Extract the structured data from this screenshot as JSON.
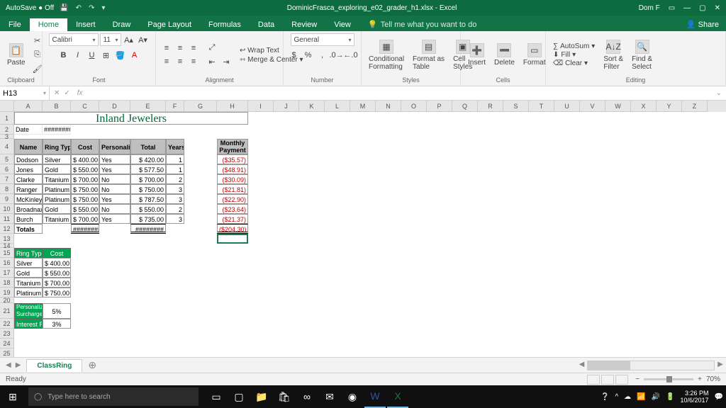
{
  "titlebar": {
    "autosave": "AutoSave ● Off",
    "title": "DominicFrasca_exploring_e02_grader_h1.xlsx - Excel",
    "user": "Dom F"
  },
  "tabs": {
    "file": "File",
    "home": "Home",
    "insert": "Insert",
    "draw": "Draw",
    "pagelayout": "Page Layout",
    "formulas": "Formulas",
    "data": "Data",
    "review": "Review",
    "view": "View",
    "tellme": "Tell me what you want to do",
    "share": "Share"
  },
  "ribbon": {
    "clipboard": {
      "label": "Clipboard",
      "paste": "Paste"
    },
    "font": {
      "label": "Font",
      "name": "Calibri",
      "size": "11"
    },
    "alignment": {
      "label": "Alignment",
      "wrap": "Wrap Text",
      "merge": "Merge & Center"
    },
    "number": {
      "label": "Number",
      "format": "General"
    },
    "styles": {
      "label": "Styles",
      "cond": "Conditional\nFormatting",
      "table": "Format as\nTable",
      "cell": "Cell\nStyles"
    },
    "cells": {
      "label": "Cells",
      "insert": "Insert",
      "delete": "Delete",
      "format": "Format"
    },
    "editing": {
      "label": "Editing",
      "autosum": "AutoSum",
      "fill": "Fill",
      "clear": "Clear",
      "sort": "Sort &\nFilter",
      "find": "Find &\nSelect"
    }
  },
  "namebox": "H13",
  "fx": "",
  "cols": [
    "A",
    "B",
    "C",
    "D",
    "E",
    "F",
    "G",
    "H",
    "I",
    "J",
    "K",
    "L",
    "M",
    "N",
    "O",
    "P",
    "Q",
    "R",
    "S",
    "T",
    "U",
    "V",
    "W",
    "X",
    "Y",
    "Z"
  ],
  "sheet": {
    "title": "Inland Jewelers",
    "date_label": "Date",
    "date_val": "########",
    "headers": [
      "Name",
      "Ring Type",
      "Cost",
      "Personalized",
      "Total",
      "Years",
      "Monthly\nPayment"
    ],
    "rows": [
      {
        "name": "Dodson",
        "type": "Silver",
        "cost": "$  400.00",
        "pers": "Yes",
        "total": "$   420.00",
        "years": "1",
        "pay": "($35.57)"
      },
      {
        "name": "Jones",
        "type": "Gold",
        "cost": "$  550.00",
        "pers": "Yes",
        "total": "$   577.50",
        "years": "1",
        "pay": "($48.91)"
      },
      {
        "name": "Clarke",
        "type": "Titanium",
        "cost": "$  700.00",
        "pers": "No",
        "total": "$   700.00",
        "years": "2",
        "pay": "($30.09)"
      },
      {
        "name": "Ranger",
        "type": "Platinum",
        "cost": "$  750.00",
        "pers": "No",
        "total": "$   750.00",
        "years": "3",
        "pay": "($21.81)"
      },
      {
        "name": "McKinley",
        "type": "Platinum",
        "cost": "$  750.00",
        "pers": "Yes",
        "total": "$   787.50",
        "years": "3",
        "pay": "($22.90)"
      },
      {
        "name": "Broadnax",
        "type": "Gold",
        "cost": "$  550.00",
        "pers": "No",
        "total": "$   550.00",
        "years": "2",
        "pay": "($23.64)"
      },
      {
        "name": "Burch",
        "type": "Titanium",
        "cost": "$  700.00",
        "pers": "Yes",
        "total": "$   735.00",
        "years": "3",
        "pay": "($21.37)"
      }
    ],
    "totals": {
      "label": "Totals",
      "cost": "########",
      "total": "########",
      "pay": "($204.30)"
    },
    "lookup_hdr": [
      "Ring Type",
      "Cost"
    ],
    "lookup": [
      [
        "Silver",
        "$ 400.00"
      ],
      [
        "Gold",
        "$ 550.00"
      ],
      [
        "Titanium",
        "$ 700.00"
      ],
      [
        "Platinum",
        "$ 750.00"
      ]
    ],
    "surcharge": {
      "label": "Personalizing\nSurcharge",
      "val": "5%"
    },
    "interest": {
      "label": "Interest Rate",
      "val": "3%"
    }
  },
  "sheettab": "ClassRing",
  "status": {
    "ready": "Ready",
    "zoom": "70%"
  },
  "taskbar": {
    "search": "Type here to search",
    "time": "3:26 PM",
    "date": "10/6/2017"
  }
}
